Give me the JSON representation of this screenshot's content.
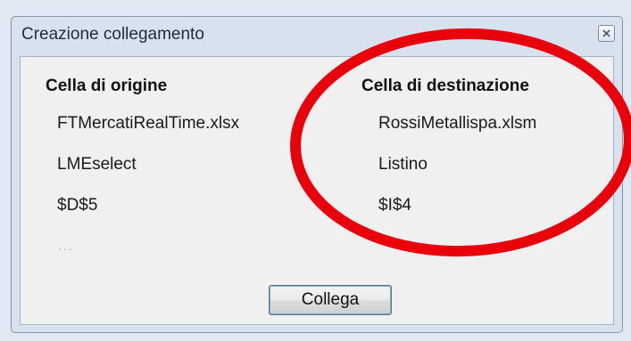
{
  "window": {
    "title": "Creazione collegamento",
    "close_icon": "close-icon"
  },
  "origin": {
    "heading": "Cella di origine",
    "file": "FTMercatiRealTime.xlsx",
    "sheet": "LMEselect",
    "cell": "$D$5",
    "more": "..."
  },
  "destination": {
    "heading": "Cella di destinazione",
    "file": "RossiMetallispa.xlsm",
    "sheet": "Listino",
    "cell": "$I$4"
  },
  "actions": {
    "link_label": "Collega"
  },
  "colors": {
    "annotation_ellipse": "#e8000b",
    "button_focus": "#5fb1e8"
  }
}
